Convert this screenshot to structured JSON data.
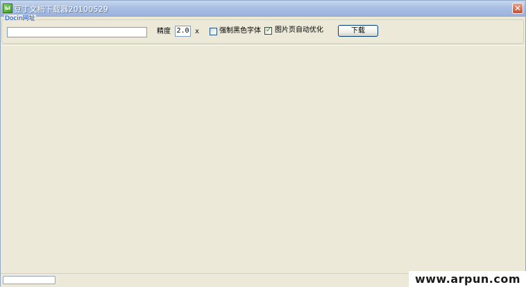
{
  "window": {
    "title": "豆丁文档下载器20100529",
    "app_icon_glyph": "ы",
    "close_glyph": "✕"
  },
  "group": {
    "legend": "Docin网址"
  },
  "form": {
    "url_value": "",
    "precision_label": "精度",
    "precision_value": "2.0",
    "precision_unit": "x",
    "force_black_font_label": "强制黑色字体",
    "force_black_font_checked": false,
    "auto_optimize_label": "图片页自动优化",
    "auto_optimize_checked": true,
    "download_label": "下载"
  },
  "status": {
    "progress": 0.0
  },
  "watermark": {
    "text": "www.arpun.com"
  },
  "colors": {
    "window_bg": "#ece9d8",
    "legend_text": "#0046d5",
    "title_text": "#ffffff"
  }
}
